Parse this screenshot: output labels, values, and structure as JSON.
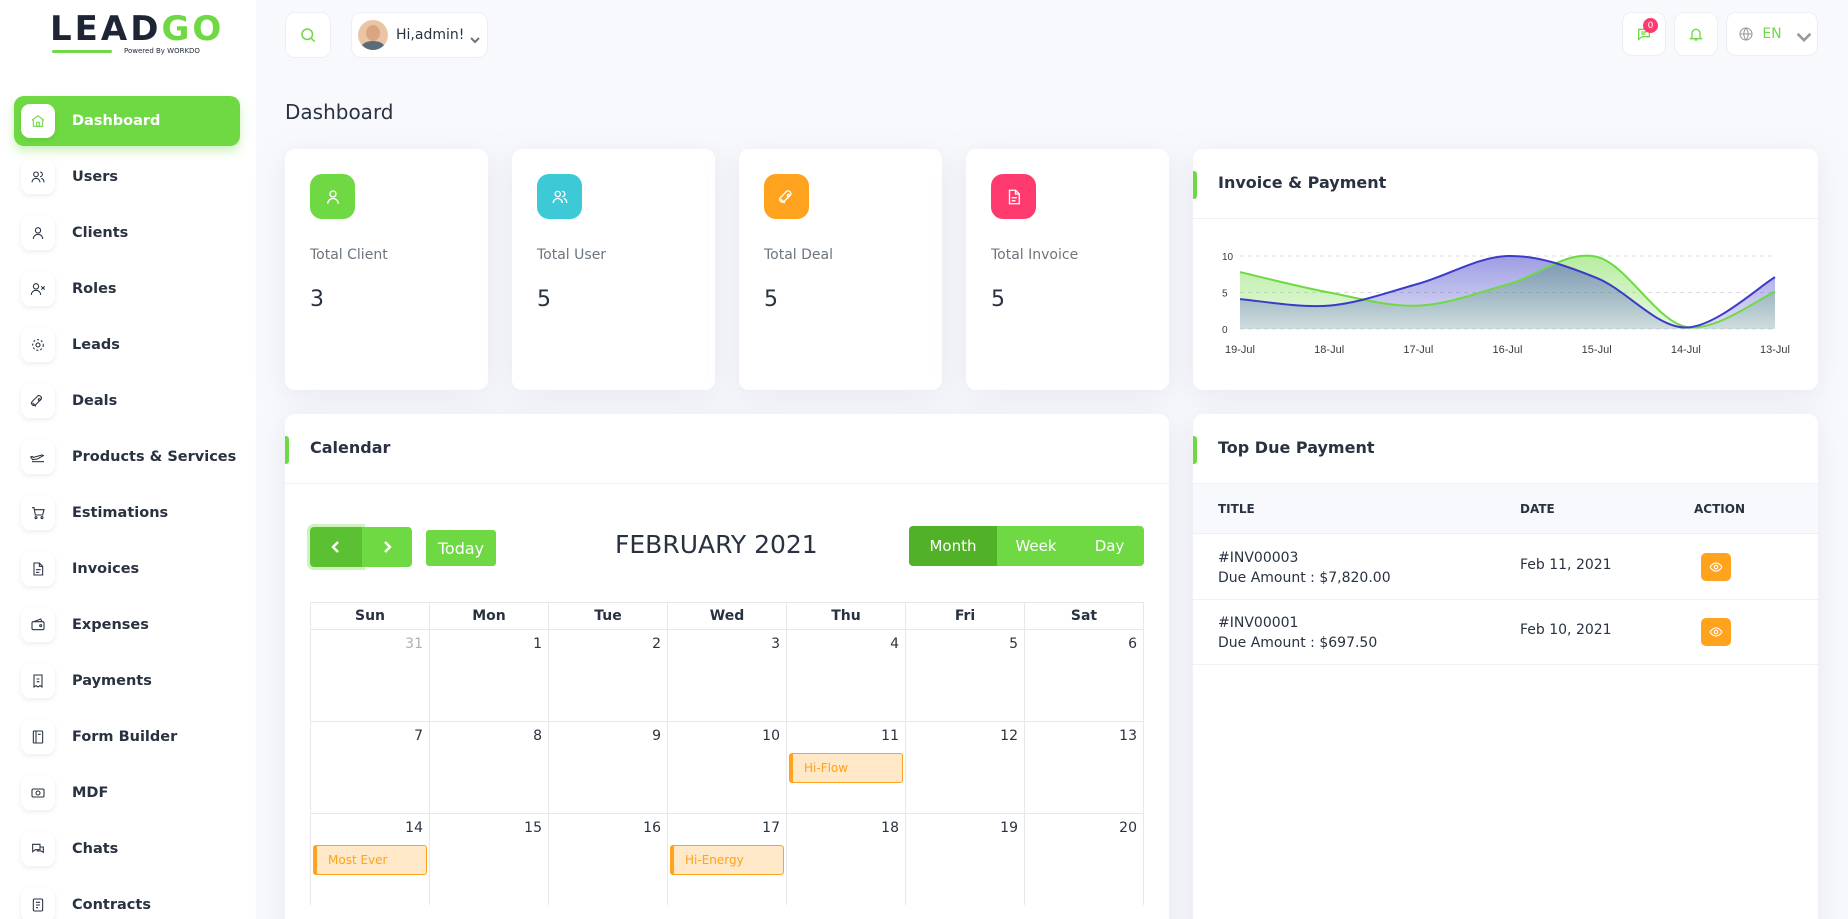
{
  "brand": {
    "name_a": "LEAD",
    "name_b": "GO",
    "tagline": "Powered By WORKDO"
  },
  "sidebar": {
    "items": [
      {
        "label": "Dashboard",
        "icon": "home-icon",
        "active": true
      },
      {
        "label": "Users",
        "icon": "users-icon"
      },
      {
        "label": "Clients",
        "icon": "user-icon"
      },
      {
        "label": "Roles",
        "icon": "user-x-icon"
      },
      {
        "label": "Leads",
        "icon": "target-icon"
      },
      {
        "label": "Deals",
        "icon": "rocket-icon"
      },
      {
        "label": "Products & Services",
        "icon": "plane-icon"
      },
      {
        "label": "Estimations",
        "icon": "cart-icon"
      },
      {
        "label": "Invoices",
        "icon": "file-icon"
      },
      {
        "label": "Expenses",
        "icon": "wallet-icon"
      },
      {
        "label": "Payments",
        "icon": "receipt-icon"
      },
      {
        "label": "Form Builder",
        "icon": "notebook-icon"
      },
      {
        "label": "MDF",
        "icon": "cash-icon"
      },
      {
        "label": "Chats",
        "icon": "message-icon"
      },
      {
        "label": "Contracts",
        "icon": "contract-icon"
      }
    ]
  },
  "topbar": {
    "user_greeting": "Hi,admin!",
    "messages_badge": "0",
    "language": "EN"
  },
  "page": {
    "title": "Dashboard"
  },
  "stats": [
    {
      "label": "Total Client",
      "value": "3",
      "color": "#6fd943",
      "icon": "user-icon"
    },
    {
      "label": "Total User",
      "value": "5",
      "color": "#3ec9d6",
      "icon": "users-icon"
    },
    {
      "label": "Total Deal",
      "value": "5",
      "color": "#ffa21d",
      "icon": "rocket-icon"
    },
    {
      "label": "Total Invoice",
      "value": "5",
      "color": "#ff3a6e",
      "icon": "file-icon"
    }
  ],
  "invoice_chart": {
    "title": "Invoice & Payment",
    "colors": {
      "green": "#6fd943",
      "blue": "#3c3bc8"
    }
  },
  "chart_data": {
    "type": "area",
    "x": [
      "19-Jul",
      "18-Jul",
      "17-Jul",
      "16-Jul",
      "15-Jul",
      "14-Jul",
      "13-Jul"
    ],
    "yticks": [
      0,
      5,
      10
    ],
    "ylim": [
      0,
      10
    ],
    "grid": true,
    "series": [
      {
        "name": "",
        "color": "#6fd943",
        "values": [
          7.8,
          5.0,
          3.2,
          6.1,
          9.9,
          0.3,
          5.1
        ]
      },
      {
        "name": "",
        "color": "#3c3bc8",
        "values": [
          4.1,
          3.2,
          6.2,
          10.0,
          7.0,
          0.2,
          7.1
        ]
      }
    ]
  },
  "calendar": {
    "title": "Calendar",
    "today_label": "Today",
    "month_label": "FEBRUARY 2021",
    "views": [
      "Month",
      "Week",
      "Day"
    ],
    "active_view": "Month",
    "weekdays": [
      "Sun",
      "Mon",
      "Tue",
      "Wed",
      "Thu",
      "Fri",
      "Sat"
    ],
    "weeks": [
      [
        {
          "d": "31",
          "muted": true
        },
        {
          "d": "1"
        },
        {
          "d": "2"
        },
        {
          "d": "3"
        },
        {
          "d": "4"
        },
        {
          "d": "5"
        },
        {
          "d": "6"
        }
      ],
      [
        {
          "d": "7"
        },
        {
          "d": "8"
        },
        {
          "d": "9"
        },
        {
          "d": "10"
        },
        {
          "d": "11",
          "event": "Hi-Flow"
        },
        {
          "d": "12"
        },
        {
          "d": "13"
        }
      ],
      [
        {
          "d": "14",
          "event": "Most Ever"
        },
        {
          "d": "15"
        },
        {
          "d": "16"
        },
        {
          "d": "17",
          "event": "Hi-Energy"
        },
        {
          "d": "18"
        },
        {
          "d": "19"
        },
        {
          "d": "20"
        }
      ]
    ]
  },
  "due_payments": {
    "title": "Top Due Payment",
    "columns": [
      "TITLE",
      "DATE",
      "ACTION"
    ],
    "rows": [
      {
        "invoice": "#INV00003",
        "amount": "Due Amount : $7,820.00",
        "date": "Feb 11, 2021"
      },
      {
        "invoice": "#INV00001",
        "amount": "Due Amount : $697.50",
        "date": "Feb 10, 2021"
      }
    ]
  }
}
